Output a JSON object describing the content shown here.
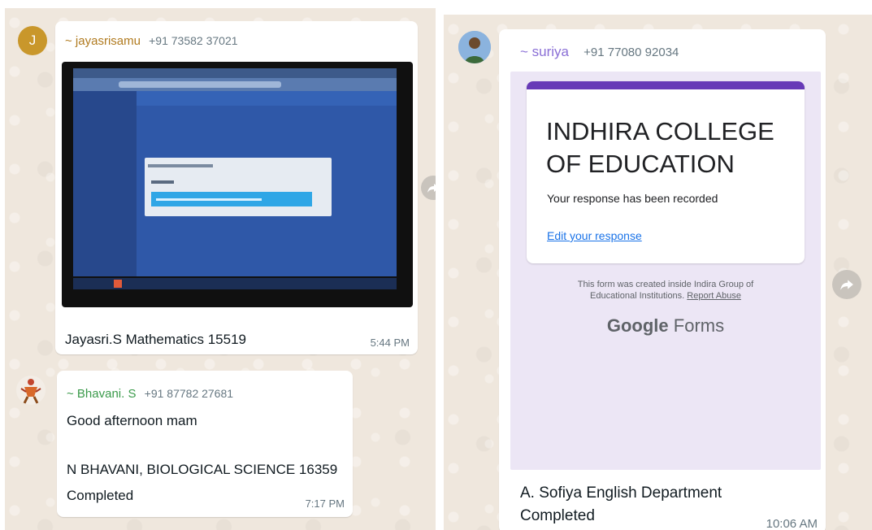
{
  "messages": [
    {
      "sender": "~ jayasrisamu",
      "phone": "+91 73582 37021",
      "avatar_letter": "J",
      "caption": "Jayasri.S Mathematics 15519",
      "time": "5:44 PM"
    },
    {
      "sender": "~ Bhavani. S",
      "phone": "+91 87782 27681",
      "line1": "Good afternoon mam",
      "line2": "N BHAVANI, BIOLOGICAL SCIENCE 16359",
      "line3": "Completed",
      "time": "7:17 PM"
    },
    {
      "sender": "~ suriya",
      "phone": "+91 77080 92034",
      "line1": "A. Sofiya English Department",
      "line2": "Completed",
      "time": "10:06 AM"
    }
  ],
  "form": {
    "title_line1": "INDHIRA COLLEGE",
    "title_line2": "OF EDUCATION",
    "response_text": "Your response has been recorded",
    "edit_link": "Edit your response",
    "footer_line1": "This form was created inside Indira Group of",
    "footer_line2": "Educational Institutions.",
    "report_abuse": "Report Abuse",
    "logo_google": "Google",
    "logo_forms": "Forms"
  },
  "colors": {
    "sender_orange": "#b07a1e",
    "sender_green": "#3a9a4a",
    "sender_purple": "#8a6fd6",
    "avatar_gold": "#c9972b",
    "form_purple": "#673ab7"
  }
}
